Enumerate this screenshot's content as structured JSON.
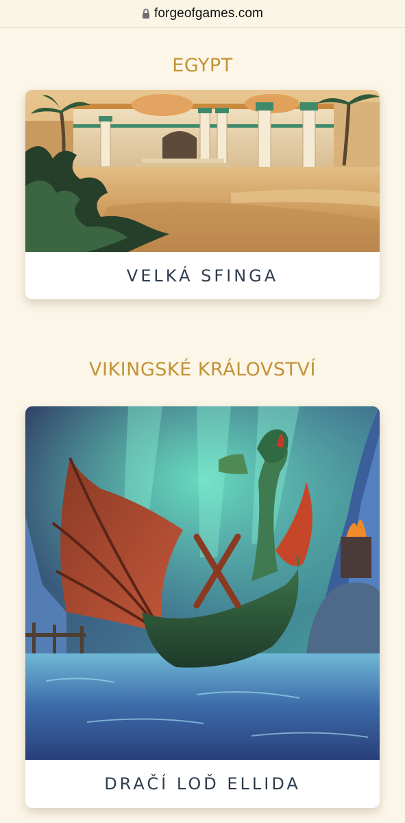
{
  "browser": {
    "url": "forgeofgames.com",
    "lock_icon": "lock-icon"
  },
  "sections": [
    {
      "title": "EGYPT",
      "card": {
        "caption": "VELKÁ SFINGA",
        "image_icon": "egyptian-temple-illustration"
      }
    },
    {
      "title": "VIKINGSKÉ KRÁLOVSTVÍ",
      "card": {
        "caption": "DRAČÍ LOĎ ELLIDA",
        "image_icon": "viking-dragon-ship-illustration"
      }
    }
  ],
  "colors": {
    "background": "#fcf6e8",
    "heading": "#c29338",
    "caption": "#2d3c4e",
    "card": "#ffffff"
  }
}
